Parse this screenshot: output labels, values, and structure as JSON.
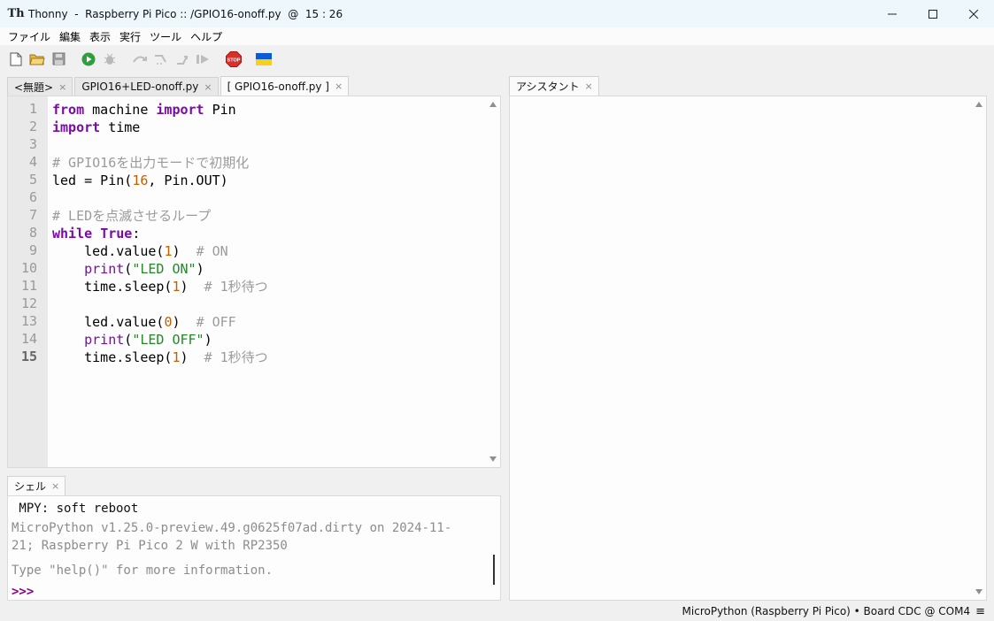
{
  "window": {
    "title": "Thonny  -  Raspberry Pi Pico :: /GPIO16-onoff.py  @  15 : 26",
    "app_icon_text": "Th"
  },
  "menu": [
    "ファイル",
    "編集",
    "表示",
    "実行",
    "ツール",
    "ヘルプ"
  ],
  "toolbar": {
    "buttons": [
      "new-file-icon",
      "open-folder-icon",
      "save-icon",
      "run-icon",
      "debug-icon",
      "step-over-icon",
      "step-into-icon",
      "step-out-icon",
      "resume-icon",
      "stop-icon",
      "ukraine-flag-icon"
    ],
    "stop_label": "STOP",
    "colors": {
      "run": "#2f9e3f",
      "stop": "#d9302c",
      "flag_blue": "#0b5bd3",
      "flag_yellow": "#f7d117"
    }
  },
  "editor": {
    "tabs": [
      {
        "label": "<無題>",
        "active": false
      },
      {
        "label": "GPIO16+LED-onoff.py",
        "active": false
      },
      {
        "label": "[ GPIO16-onoff.py ]",
        "active": true
      }
    ],
    "tab_close": "×",
    "line_numbers": [
      "1",
      "2",
      "3",
      "4",
      "5",
      "6",
      "7",
      "8",
      "9",
      "10",
      "11",
      "12",
      "13",
      "14",
      "15"
    ]
  },
  "shell": {
    "tab_label": "シェル",
    "lines": [
      " MPY: soft reboot",
      "MicroPython v1.25.0-preview.49.g0625f07ad.dirty on 2024-11-",
      "21; Raspberry Pi Pico 2 W with RP2350",
      "Type \"help()\" for more information."
    ],
    "prompt": ">>>"
  },
  "assistant": {
    "tab_label": "アシスタント"
  },
  "status": {
    "interpreter": "MicroPython (Raspberry Pi Pico)  •  Board CDC @ COM4",
    "menu_glyph": "≡"
  }
}
